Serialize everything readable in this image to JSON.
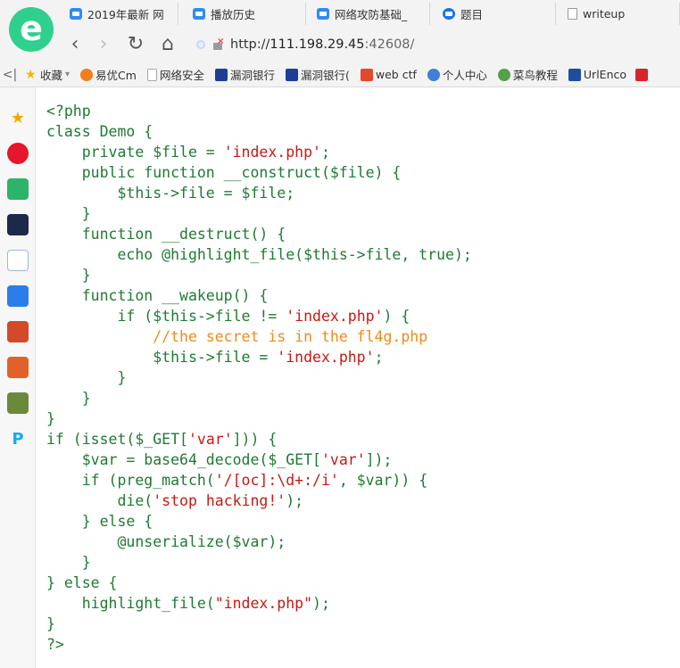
{
  "browser": {
    "logo_letter": "e",
    "tabs": [
      {
        "label": "2019年最新 网",
        "fade": "",
        "icon": "video"
      },
      {
        "label": "播放历史",
        "fade": "",
        "icon": "video"
      },
      {
        "label": "网络攻防基础_",
        "fade": "",
        "icon": "video"
      },
      {
        "label": "题目",
        "fade": "",
        "icon": "q"
      },
      {
        "label": "writeup",
        "fade": "",
        "icon": "doc"
      }
    ],
    "nav": {
      "back": "‹",
      "forward": "›",
      "reload": "↻",
      "home": "⌂"
    },
    "url": {
      "prefix": "http://",
      "host": "111.198.29.45",
      "port": ":42608/"
    },
    "bookmarks": [
      {
        "label": "收藏",
        "icon_color": "#f5b400",
        "icon": "star-icon"
      },
      {
        "label": "易优Cm",
        "icon_color": "#f07d1e",
        "icon": "e-icon"
      },
      {
        "label": "网络安全",
        "icon_color": "#b8b8b8",
        "icon": "page-icon"
      },
      {
        "label": "漏洞银行",
        "icon_color": "#1c3f95",
        "icon": "bank-icon"
      },
      {
        "label": "漏洞银行(",
        "icon_color": "#1c3f95",
        "icon": "bank-icon"
      },
      {
        "label": "web ctf",
        "icon_color": "#e04b2c",
        "icon": "jian-icon"
      },
      {
        "label": "个人中心",
        "icon_color": "#3f7fd8",
        "icon": "user-icon"
      },
      {
        "label": "菜鸟教程",
        "icon_color": "#54a14a",
        "icon": "runoob-icon"
      },
      {
        "label": "UrlEnco",
        "icon_color": "#1e4f9e",
        "icon": "url-icon"
      }
    ],
    "sidebar_icons": [
      {
        "name": "favorites-star-icon",
        "color": "#f2a900",
        "glyph": "★"
      },
      {
        "name": "weibo-icon",
        "color": "#e6162d",
        "glyph": "微"
      },
      {
        "name": "mail-icon",
        "color": "#2eb36b",
        "glyph": "✉"
      },
      {
        "name": "news-icon",
        "color": "#1c2a4a",
        "glyph": "网"
      },
      {
        "name": "notes-icon",
        "color": "#3b7ddd",
        "glyph": "W"
      },
      {
        "name": "chat-icon",
        "color": "#2b7de9",
        "glyph": "◆"
      },
      {
        "name": "game-app-1-icon",
        "color": "#d34a2a",
        "glyph": "☻"
      },
      {
        "name": "game-app-2-icon",
        "color": "#e0622a",
        "glyph": "☻"
      },
      {
        "name": "game-app-3-icon",
        "color": "#6a8a3a",
        "glyph": "☻"
      },
      {
        "name": "p-app-icon",
        "color": "#19a9f0",
        "glyph": "P"
      }
    ]
  },
  "code_lines": [
    [
      [
        "d",
        "<?php"
      ]
    ],
    [
      [
        "k",
        "class Demo {"
      ]
    ],
    [
      [
        "k",
        "    private $file = "
      ],
      [
        "s",
        "'index.php'"
      ],
      [
        "k",
        ";"
      ]
    ],
    [
      [
        "k",
        "    public function __construct($file) {"
      ]
    ],
    [
      [
        "k",
        "        $this->file = $file;"
      ]
    ],
    [
      [
        "k",
        "    }"
      ]
    ],
    [
      [
        "k",
        "    function __destruct() {"
      ]
    ],
    [
      [
        "k",
        "        echo @highlight_file($this->file, true);"
      ]
    ],
    [
      [
        "k",
        "    }"
      ]
    ],
    [
      [
        "k",
        "    function __wakeup() {"
      ]
    ],
    [
      [
        "k",
        "        if ($this->file != "
      ],
      [
        "s",
        "'index.php'"
      ],
      [
        "k",
        ") {"
      ]
    ],
    [
      [
        "c",
        "            //the secret is in the fl4g.php"
      ]
    ],
    [
      [
        "k",
        "            $this->file = "
      ],
      [
        "s",
        "'index.php'"
      ],
      [
        "k",
        ";"
      ]
    ],
    [
      [
        "k",
        "        }"
      ]
    ],
    [
      [
        "k",
        "    }"
      ]
    ],
    [
      [
        "k",
        "}"
      ]
    ],
    [
      [
        "k",
        "if (isset($_GET["
      ],
      [
        "s",
        "'var'"
      ],
      [
        "k",
        "])) {"
      ]
    ],
    [
      [
        "k",
        "    $var = base64_decode($_GET["
      ],
      [
        "s",
        "'var'"
      ],
      [
        "k",
        "]);"
      ]
    ],
    [
      [
        "k",
        "    if (preg_match("
      ],
      [
        "s",
        "'/[oc]:\\d+:/i'"
      ],
      [
        "k",
        ", $var)) {"
      ]
    ],
    [
      [
        "k",
        "        die("
      ],
      [
        "s",
        "'stop hacking!'"
      ],
      [
        "k",
        ");"
      ]
    ],
    [
      [
        "k",
        "    } else {"
      ]
    ],
    [
      [
        "k",
        "        @unserialize($var);"
      ]
    ],
    [
      [
        "k",
        "    }"
      ]
    ],
    [
      [
        "k",
        "} else {"
      ]
    ],
    [
      [
        "k",
        "    highlight_file("
      ],
      [
        "s",
        "\"index.php\""
      ],
      [
        "k",
        ");"
      ]
    ],
    [
      [
        "k",
        "}"
      ]
    ],
    [
      [
        "d",
        "?>"
      ]
    ]
  ]
}
